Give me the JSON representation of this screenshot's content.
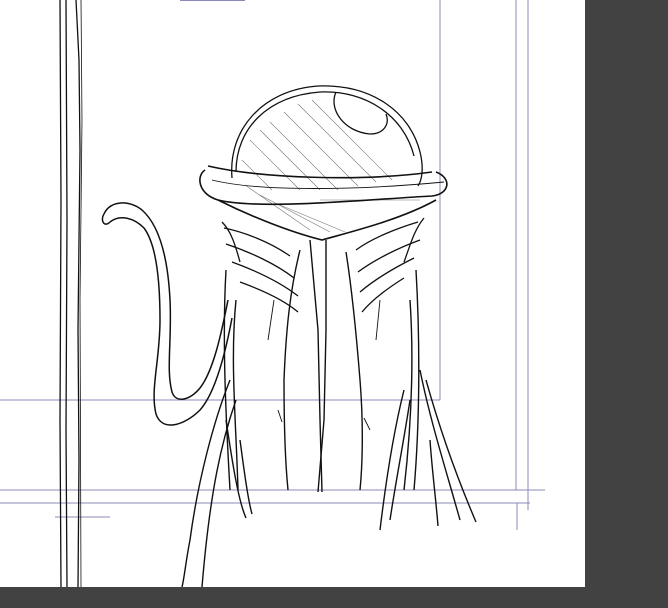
{
  "app": {
    "workspace_color": "#424242",
    "canvas_color": "#ffffff",
    "guide_color": "#8a8ab8",
    "ink_color": "#111111"
  },
  "canvas": {
    "content": "sketch-figure-covering-face"
  }
}
